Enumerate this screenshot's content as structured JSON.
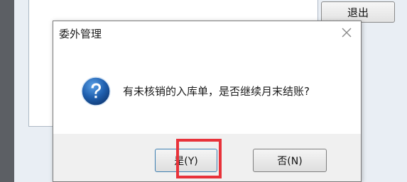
{
  "parent": {
    "exit_label": "退出"
  },
  "dialog": {
    "title": "委外管理",
    "message": "有未核销的入库单，是否继续月末结账?",
    "yes_label": "是(Y)",
    "no_label": "否(N)"
  },
  "icons": {
    "close": "close-icon",
    "question": "question-icon"
  },
  "colors": {
    "highlight": "#e8323a",
    "question_icon": "#1f5fae"
  }
}
